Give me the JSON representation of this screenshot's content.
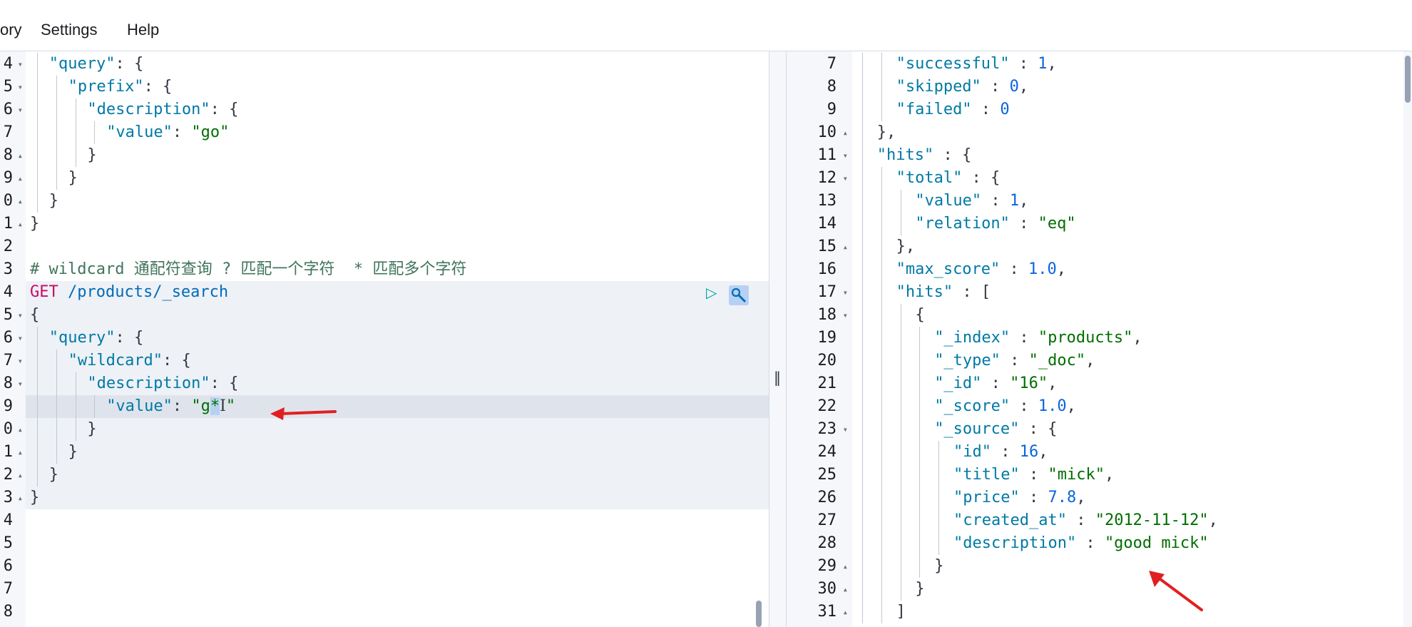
{
  "menu": {
    "items": [
      {
        "label": "ory"
      },
      {
        "label": "Settings"
      },
      {
        "label": "Help"
      }
    ]
  },
  "left_editor": {
    "lines": [
      {
        "num": "4",
        "fold": "▾",
        "indent": 1,
        "parts": [
          [
            "k",
            "\"query\""
          ],
          [
            "p",
            ": {"
          ]
        ]
      },
      {
        "num": "5",
        "fold": "▾",
        "indent": 2,
        "parts": [
          [
            "k",
            "\"prefix\""
          ],
          [
            "p",
            ": {"
          ]
        ]
      },
      {
        "num": "6",
        "fold": "▾",
        "indent": 3,
        "parts": [
          [
            "k",
            "\"description\""
          ],
          [
            "p",
            ": {"
          ]
        ]
      },
      {
        "num": "7",
        "fold": "",
        "indent": 4,
        "parts": [
          [
            "k",
            "\"value\""
          ],
          [
            "p",
            ": "
          ],
          [
            "s",
            "\"go\""
          ]
        ]
      },
      {
        "num": "8",
        "fold": "▴",
        "indent": 3,
        "parts": [
          [
            "p",
            "}"
          ]
        ]
      },
      {
        "num": "9",
        "fold": "▴",
        "indent": 2,
        "parts": [
          [
            "p",
            "}"
          ]
        ]
      },
      {
        "num": "0",
        "fold": "▴",
        "indent": 1,
        "parts": [
          [
            "p",
            "}"
          ]
        ]
      },
      {
        "num": "1",
        "fold": "▴",
        "indent": 0,
        "parts": [
          [
            "p",
            "}"
          ]
        ]
      },
      {
        "num": "2",
        "fold": "",
        "indent": 0,
        "parts": []
      },
      {
        "num": "3",
        "fold": "",
        "indent": 0,
        "parts": [
          [
            "comment",
            "# wildcard 通配符查询 ? 匹配一个字符  * 匹配多个字符"
          ]
        ]
      },
      {
        "num": "4",
        "fold": "",
        "indent": 0,
        "parts": [
          [
            "method",
            "GET"
          ],
          [
            "url",
            " /products/_search"
          ]
        ]
      },
      {
        "num": "5",
        "fold": "▾",
        "indent": 0,
        "parts": [
          [
            "p",
            "{"
          ]
        ]
      },
      {
        "num": "6",
        "fold": "▾",
        "indent": 1,
        "parts": [
          [
            "k",
            "\"query\""
          ],
          [
            "p",
            ": {"
          ]
        ]
      },
      {
        "num": "7",
        "fold": "▾",
        "indent": 2,
        "parts": [
          [
            "k",
            "\"wildcard\""
          ],
          [
            "p",
            ": {"
          ]
        ]
      },
      {
        "num": "8",
        "fold": "▾",
        "indent": 3,
        "parts": [
          [
            "k",
            "\"description\""
          ],
          [
            "p",
            ": {"
          ]
        ]
      },
      {
        "num": "9",
        "fold": "",
        "indent": 4,
        "parts": [
          [
            "k",
            "\"value\""
          ],
          [
            "p",
            ": "
          ],
          [
            "s",
            "\"g"
          ],
          [
            "sel",
            "*"
          ],
          [
            "cursor",
            "I"
          ],
          [
            "s",
            "\""
          ]
        ]
      },
      {
        "num": "0",
        "fold": "▴",
        "indent": 3,
        "parts": [
          [
            "p",
            "}"
          ]
        ]
      },
      {
        "num": "1",
        "fold": "▴",
        "indent": 2,
        "parts": [
          [
            "p",
            "}"
          ]
        ]
      },
      {
        "num": "2",
        "fold": "▴",
        "indent": 1,
        "parts": [
          [
            "p",
            "}"
          ]
        ]
      },
      {
        "num": "3",
        "fold": "▴",
        "indent": 0,
        "parts": [
          [
            "p",
            "}"
          ]
        ]
      },
      {
        "num": "4",
        "fold": "",
        "indent": 0,
        "parts": []
      },
      {
        "num": "5",
        "fold": "",
        "indent": 0,
        "parts": []
      },
      {
        "num": "6",
        "fold": "",
        "indent": 0,
        "parts": []
      },
      {
        "num": "7",
        "fold": "",
        "indent": 0,
        "parts": []
      },
      {
        "num": "8",
        "fold": "",
        "indent": 0,
        "parts": []
      }
    ]
  },
  "right_editor": {
    "lines": [
      {
        "num": "7",
        "fold": "",
        "indent": 2,
        "parts": [
          [
            "k",
            "\"successful\""
          ],
          [
            "p",
            " : "
          ],
          [
            "n",
            "1"
          ],
          [
            "p",
            ","
          ]
        ]
      },
      {
        "num": "8",
        "fold": "",
        "indent": 2,
        "parts": [
          [
            "k",
            "\"skipped\""
          ],
          [
            "p",
            " : "
          ],
          [
            "n",
            "0"
          ],
          [
            "p",
            ","
          ]
        ]
      },
      {
        "num": "9",
        "fold": "",
        "indent": 2,
        "parts": [
          [
            "k",
            "\"failed\""
          ],
          [
            "p",
            " : "
          ],
          [
            "n",
            "0"
          ]
        ]
      },
      {
        "num": "10",
        "fold": "▴",
        "indent": 1,
        "parts": [
          [
            "p",
            "},"
          ]
        ]
      },
      {
        "num": "11",
        "fold": "▾",
        "indent": 1,
        "parts": [
          [
            "k",
            "\"hits\""
          ],
          [
            "p",
            " : {"
          ]
        ]
      },
      {
        "num": "12",
        "fold": "▾",
        "indent": 2,
        "parts": [
          [
            "k",
            "\"total\""
          ],
          [
            "p",
            " : {"
          ]
        ]
      },
      {
        "num": "13",
        "fold": "",
        "indent": 3,
        "parts": [
          [
            "k",
            "\"value\""
          ],
          [
            "p",
            " : "
          ],
          [
            "n",
            "1"
          ],
          [
            "p",
            ","
          ]
        ]
      },
      {
        "num": "14",
        "fold": "",
        "indent": 3,
        "parts": [
          [
            "k",
            "\"relation\""
          ],
          [
            "p",
            " : "
          ],
          [
            "s",
            "\"eq\""
          ]
        ]
      },
      {
        "num": "15",
        "fold": "▴",
        "indent": 2,
        "parts": [
          [
            "p",
            "},"
          ]
        ]
      },
      {
        "num": "16",
        "fold": "",
        "indent": 2,
        "parts": [
          [
            "k",
            "\"max_score\""
          ],
          [
            "p",
            " : "
          ],
          [
            "n",
            "1.0"
          ],
          [
            "p",
            ","
          ]
        ]
      },
      {
        "num": "17",
        "fold": "▾",
        "indent": 2,
        "parts": [
          [
            "k",
            "\"hits\""
          ],
          [
            "p",
            " : ["
          ]
        ]
      },
      {
        "num": "18",
        "fold": "▾",
        "indent": 3,
        "parts": [
          [
            "p",
            "{"
          ]
        ]
      },
      {
        "num": "19",
        "fold": "",
        "indent": 4,
        "parts": [
          [
            "k",
            "\"_index\""
          ],
          [
            "p",
            " : "
          ],
          [
            "s",
            "\"products\""
          ],
          [
            "p",
            ","
          ]
        ]
      },
      {
        "num": "20",
        "fold": "",
        "indent": 4,
        "parts": [
          [
            "k",
            "\"_type\""
          ],
          [
            "p",
            " : "
          ],
          [
            "s",
            "\"_doc\""
          ],
          [
            "p",
            ","
          ]
        ]
      },
      {
        "num": "21",
        "fold": "",
        "indent": 4,
        "parts": [
          [
            "k",
            "\"_id\""
          ],
          [
            "p",
            " : "
          ],
          [
            "s",
            "\"16\""
          ],
          [
            "p",
            ","
          ]
        ]
      },
      {
        "num": "22",
        "fold": "",
        "indent": 4,
        "parts": [
          [
            "k",
            "\"_score\""
          ],
          [
            "p",
            " : "
          ],
          [
            "n",
            "1.0"
          ],
          [
            "p",
            ","
          ]
        ]
      },
      {
        "num": "23",
        "fold": "▾",
        "indent": 4,
        "parts": [
          [
            "k",
            "\"_source\""
          ],
          [
            "p",
            " : {"
          ]
        ]
      },
      {
        "num": "24",
        "fold": "",
        "indent": 5,
        "parts": [
          [
            "k",
            "\"id\""
          ],
          [
            "p",
            " : "
          ],
          [
            "n",
            "16"
          ],
          [
            "p",
            ","
          ]
        ]
      },
      {
        "num": "25",
        "fold": "",
        "indent": 5,
        "parts": [
          [
            "k",
            "\"title\""
          ],
          [
            "p",
            " : "
          ],
          [
            "s",
            "\"mick\""
          ],
          [
            "p",
            ","
          ]
        ]
      },
      {
        "num": "26",
        "fold": "",
        "indent": 5,
        "parts": [
          [
            "k",
            "\"price\""
          ],
          [
            "p",
            " : "
          ],
          [
            "n",
            "7.8"
          ],
          [
            "p",
            ","
          ]
        ]
      },
      {
        "num": "27",
        "fold": "",
        "indent": 5,
        "parts": [
          [
            "k",
            "\"created_at\""
          ],
          [
            "p",
            " : "
          ],
          [
            "s",
            "\"2012-11-12\""
          ],
          [
            "p",
            ","
          ]
        ]
      },
      {
        "num": "28",
        "fold": "",
        "indent": 5,
        "parts": [
          [
            "k",
            "\"description\""
          ],
          [
            "p",
            " : "
          ],
          [
            "s",
            "\"good mick\""
          ]
        ]
      },
      {
        "num": "29",
        "fold": "▴",
        "indent": 4,
        "parts": [
          [
            "p",
            "}"
          ]
        ]
      },
      {
        "num": "30",
        "fold": "▴",
        "indent": 3,
        "parts": [
          [
            "p",
            "}"
          ]
        ]
      },
      {
        "num": "31",
        "fold": "▴",
        "indent": 2,
        "parts": [
          [
            "p",
            "]"
          ]
        ]
      }
    ]
  },
  "colors": {
    "key": "#0079a5",
    "string": "#006e00",
    "number": "#0b64dd",
    "method": "#c80a68",
    "comment": "#41755c",
    "arrow": "#e02020"
  },
  "icons": {
    "run": "play-icon",
    "wrench": "wrench-icon",
    "resizer": "drag-handle-icon"
  }
}
